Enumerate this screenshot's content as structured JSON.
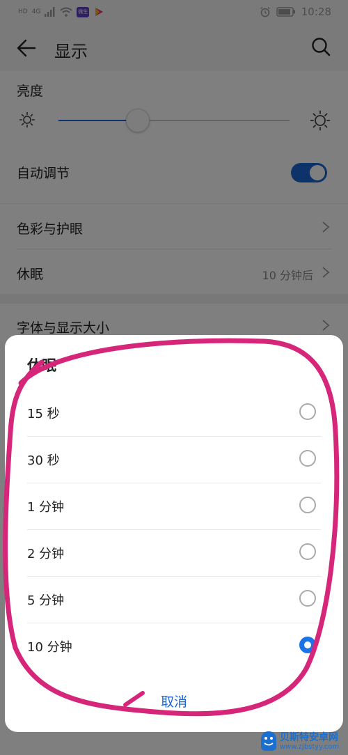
{
  "status_bar": {
    "indicators": [
      "HD",
      "4G"
    ],
    "badge_label": "微生",
    "time": "10:28",
    "icons": [
      "signal-icon",
      "wifi-icon",
      "app-badge-icon",
      "video-app-icon",
      "alarm-icon",
      "battery-icon"
    ]
  },
  "header": {
    "title": "显示",
    "icons": [
      "back-arrow-icon",
      "search-icon"
    ]
  },
  "brightness": {
    "label": "亮度",
    "level": 0.34,
    "auto_label": "自动调节",
    "auto_enabled": true,
    "icons": [
      "sun-small-icon",
      "sun-large-icon"
    ]
  },
  "settings": {
    "items": [
      {
        "label": "色彩与护眼",
        "value": ""
      },
      {
        "label": "休眠",
        "value": "10 分钟后"
      },
      {
        "label": "字体与显示大小",
        "value": ""
      }
    ]
  },
  "dialog": {
    "title": "休眠",
    "options": [
      {
        "label": "15 秒",
        "selected": false
      },
      {
        "label": "30 秒",
        "selected": false
      },
      {
        "label": "1 分钟",
        "selected": false
      },
      {
        "label": "2 分钟",
        "selected": false
      },
      {
        "label": "5 分钟",
        "selected": false
      },
      {
        "label": "10 分钟",
        "selected": true
      }
    ],
    "cancel_label": "取消"
  },
  "watermark": {
    "name": "贝斯特安卓网",
    "url": "www.zjbstyy.com"
  },
  "colors": {
    "accent": "#1a66d2",
    "annotation": "#d6267a",
    "overlay": "#000000"
  }
}
